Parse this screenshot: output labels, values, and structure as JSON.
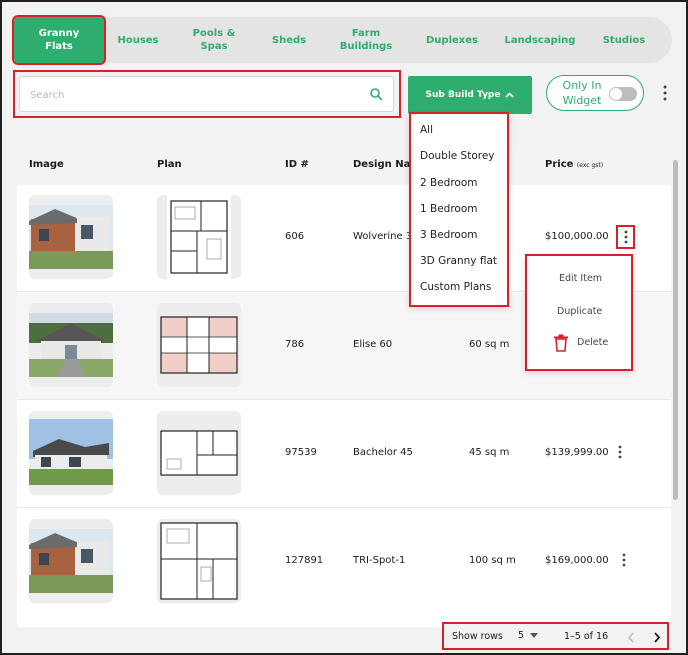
{
  "tabs": [
    {
      "label": "Granny\nFlats",
      "active": true
    },
    {
      "label": "Houses"
    },
    {
      "label": "Pools &\nSpas"
    },
    {
      "label": "Sheds"
    },
    {
      "label": "Farm\nBuildings"
    },
    {
      "label": "Duplexes"
    },
    {
      "label": "Landscaping"
    },
    {
      "label": "Studios"
    }
  ],
  "search": {
    "placeholder": "Search",
    "value": ""
  },
  "toolbar": {
    "sub_build_type": "Sub Build Type",
    "only_in_widget": "Only In Widget"
  },
  "table": {
    "headers": {
      "image": "Image",
      "plan": "Plan",
      "id": "ID #",
      "design_name": "Design Nam",
      "price": "Price",
      "price_note": "(exc gst)"
    },
    "rows": [
      {
        "id": "606",
        "design": "Wolverine 3",
        "area": "",
        "price": "$100,000.00"
      },
      {
        "id": "786",
        "design": "Elise 60",
        "area": "60 sq m",
        "price": ""
      },
      {
        "id": "97539",
        "design": "Bachelor 45",
        "area": "45 sq m",
        "price": "$139,999.00"
      },
      {
        "id": "127891",
        "design": "TRI-Spot-1",
        "area": "100 sq m",
        "price": "$169,000.00"
      }
    ]
  },
  "sub_build_menu": [
    "All",
    "Double Storey",
    "2 Bedroom",
    "1 Bedroom",
    "3 Bedroom",
    "3D Granny flat",
    "Custom Plans"
  ],
  "row_menu": {
    "edit": "Edit Item",
    "duplicate": "Duplicate",
    "delete": "Delete"
  },
  "pager": {
    "show_rows_label": "Show rows",
    "rows_value": "5",
    "range": "1–5 of 16"
  },
  "colors": {
    "accent": "#2dae6e",
    "highlight": "#d8202a"
  }
}
